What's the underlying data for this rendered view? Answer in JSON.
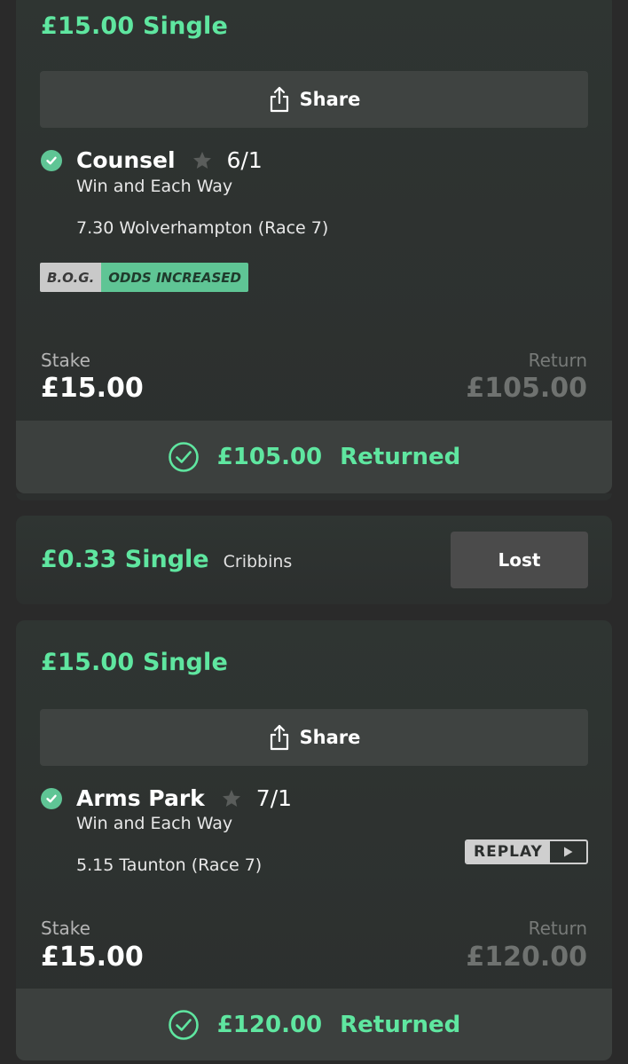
{
  "bets": [
    {
      "title": "£15.00 Single",
      "share_label": "Share",
      "selection": "Counsel",
      "odds": "6/1",
      "market": "Win and Each Way",
      "event": "7.30 Wolverhampton (Race 7)",
      "badges": [
        "B.O.G.",
        "ODDS INCREASED"
      ],
      "stake_label": "Stake",
      "stake_value": "£15.00",
      "return_label": "Return",
      "return_value": "£105.00",
      "returned_amount": "£105.00",
      "returned_label": "Returned"
    },
    {
      "title": "£0.33 Single",
      "selection": "Cribbins",
      "status": "Lost"
    },
    {
      "title": "£15.00 Single",
      "share_label": "Share",
      "selection": "Arms Park",
      "odds": "7/1",
      "market": "Win and Each Way",
      "event": "5.15 Taunton (Race 7)",
      "replay_label": "REPLAY",
      "stake_label": "Stake",
      "stake_value": "£15.00",
      "return_label": "Return",
      "return_value": "£120.00",
      "returned_amount": "£120.00",
      "returned_label": "Returned"
    }
  ],
  "colors": {
    "accent_green": "#5fe6a0",
    "check_green": "#5fc595",
    "background": "#2a2a2a",
    "card": "#2f3532"
  },
  "icons": [
    "share-icon",
    "check-icon",
    "star-icon",
    "returned-check-icon",
    "play-icon"
  ]
}
